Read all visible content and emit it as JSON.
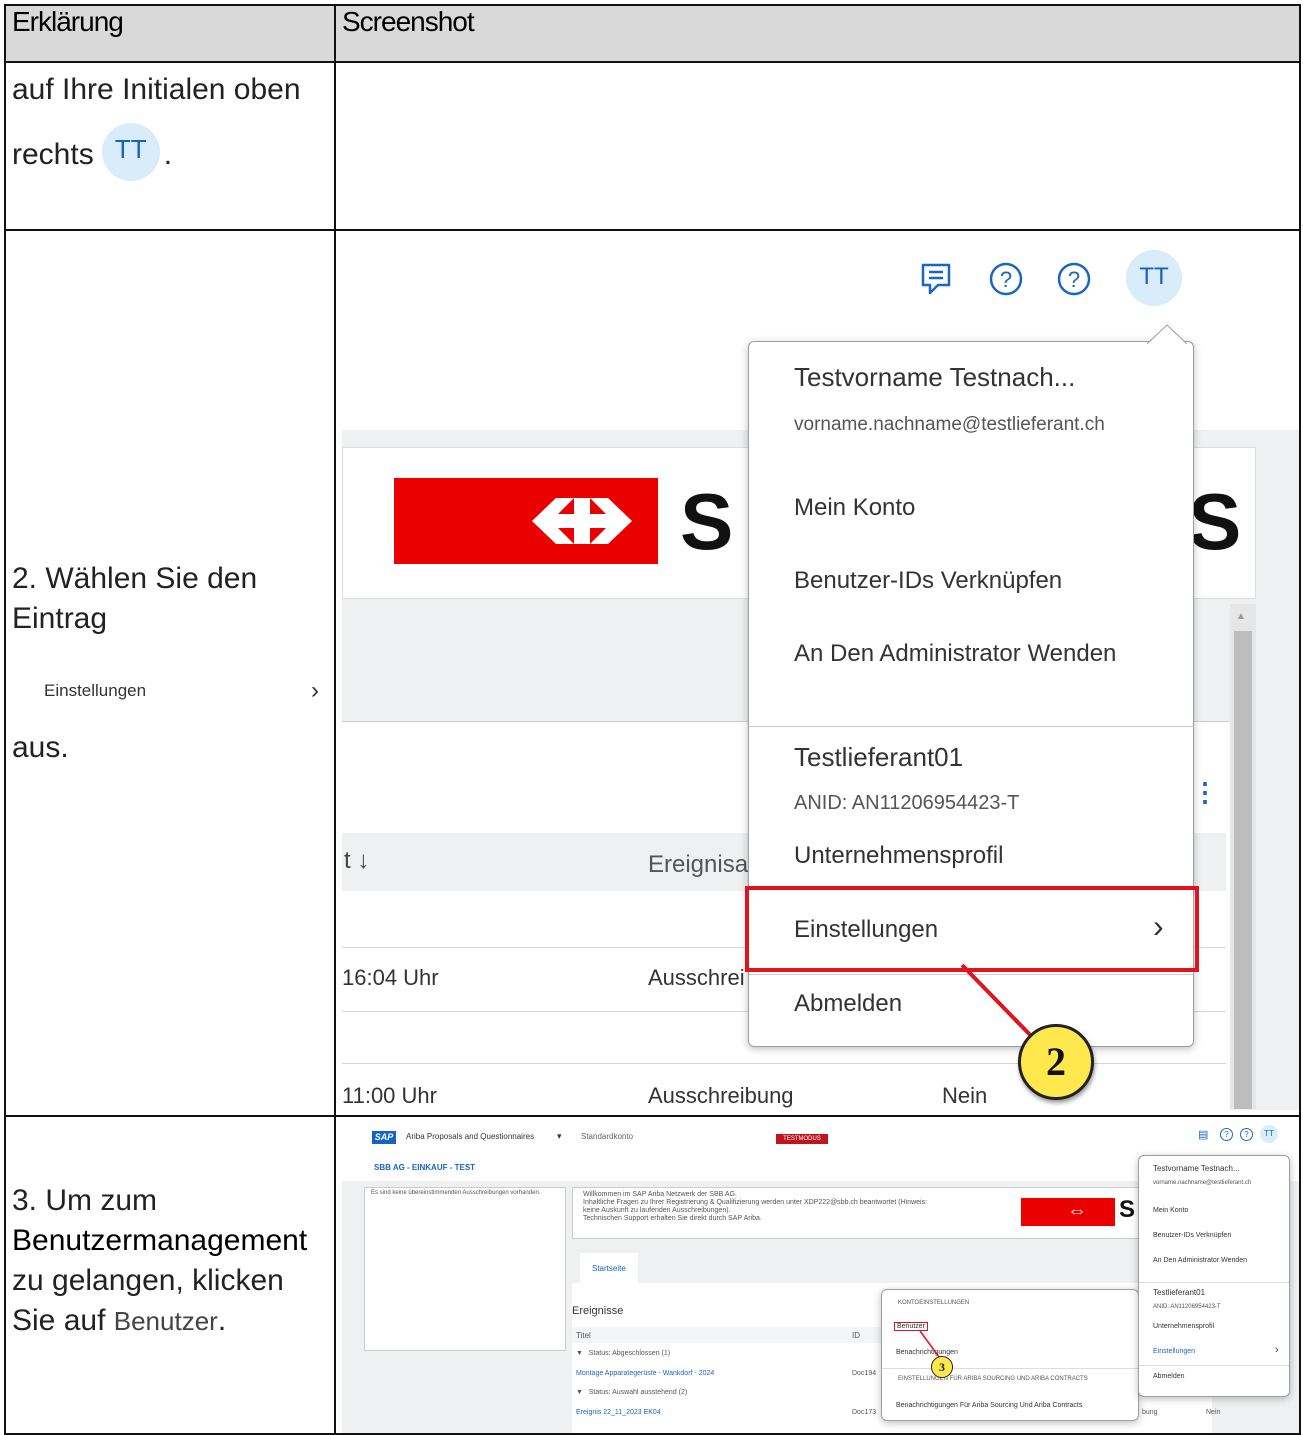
{
  "header": {
    "col1": "Erklärung",
    "col2": "Screenshot"
  },
  "row1": {
    "text_a": "auf Ihre Initialen oben",
    "text_b": "rechts",
    "initials": "TT",
    "text_c": "."
  },
  "row2": {
    "text_a": "2. Wählen Sie den",
    "text_b": "Eintrag",
    "inline_item": "Einstellungen",
    "text_c": "aus.",
    "initials": "TT",
    "menu": {
      "name": "Testvorname Testnach...",
      "email": "vorname.nachname@testlieferant.ch",
      "items_a": [
        "Mein Konto",
        "Benutzer-IDs Verknüpfen",
        "An Den Administrator Wenden"
      ],
      "company": "Testlieferant01",
      "anid": "ANID: AN11206954423-T",
      "profile": "Unternehmensprofil",
      "settings": "Einstellungen",
      "logout": "Abmelden"
    },
    "bg": {
      "logo_letter": "S",
      "col_sort": "t ↓",
      "col_event": "Ereignisar",
      "time1": "16:04 Uhr",
      "type1": "Ausschrei",
      "time2": "11:00 Uhr",
      "type2": "Ausschreibung",
      "answer2": "Nein"
    },
    "step": "2"
  },
  "row3": {
    "text_a": "3. Um zum",
    "text_b": "Benutzermanagement",
    "text_c": "zu gelangen, klicken",
    "text_d": "Sie auf",
    "inline_item": "Benutzer",
    "text_e": ".",
    "app": {
      "sap": "SAP",
      "product": "Ariba Proposals and Questionnaires",
      "account": "Standardkonto",
      "testmode": "TESTMODUS",
      "org": "SBB AG - EINKAUF - TEST",
      "no_results": "Es sind keine übereinstimmenden Ausschreibungen vorhanden.",
      "welcome_1": "Willkommen im SAP Ariba Netzwerk der SBB AG.",
      "welcome_2": "Inhaltliche Fragen zu Ihrer Registrierung & Qualifizierung werden unter XDP222@sbb.ch beantwortet (Hinweis:",
      "welcome_3": "keine Auskunft zu laufenden Ausschreibungen).",
      "welcome_4": "Technischen Support erhalten Sie direkt durch SAP Ariba.",
      "tab": "Startseite",
      "events": "Ereignisse",
      "col_title": "Titel",
      "col_id": "ID",
      "status_closed": "Status: Abgeschlossen  (1)",
      "event1": "Montage Apparategerüste - Wankdorf - 2024",
      "event1_id": "Doc194",
      "status_pending": "Status: Auswahl ausstehend  (2)",
      "event2": "Ereignis 22_11_2023 EK04",
      "event2_id": "Doc173",
      "event2_type": "bung",
      "event2_answer": "Nein",
      "initials": "TT",
      "logo_letter": "S",
      "menu_name": "Testvorname Testnach...",
      "menu_email": "vorname.nachname@testlieferant.ch",
      "menu_items_a": [
        "Mein Konto",
        "Benutzer-IDs Verknüpfen",
        "An Den Administrator Wenden"
      ],
      "menu_company": "Testlieferant01",
      "menu_anid": "ANID: AN11206954423-T",
      "menu_profile": "Unternehmensprofil",
      "menu_settings": "Einstellungen",
      "menu_logout": "Abmelden",
      "sub_head1": "KONTOEINSTELLUNGEN",
      "sub_users": "Benutzer",
      "sub_notif": "Benachrichtigungen",
      "sub_head2": "EINSTELLUNGEN FÜR ARIBA SOURCING UND ARIBA CONTRACTS",
      "sub_notif2": "Benachrichtigungen Für Ariba Sourcing Und Ariba Contracts"
    },
    "step": "3"
  },
  "colors": {
    "sbb_red": "#eb0000",
    "highlight": "#e0141e",
    "link": "#1a66c2",
    "avatar_bg": "#d8ecf9"
  }
}
